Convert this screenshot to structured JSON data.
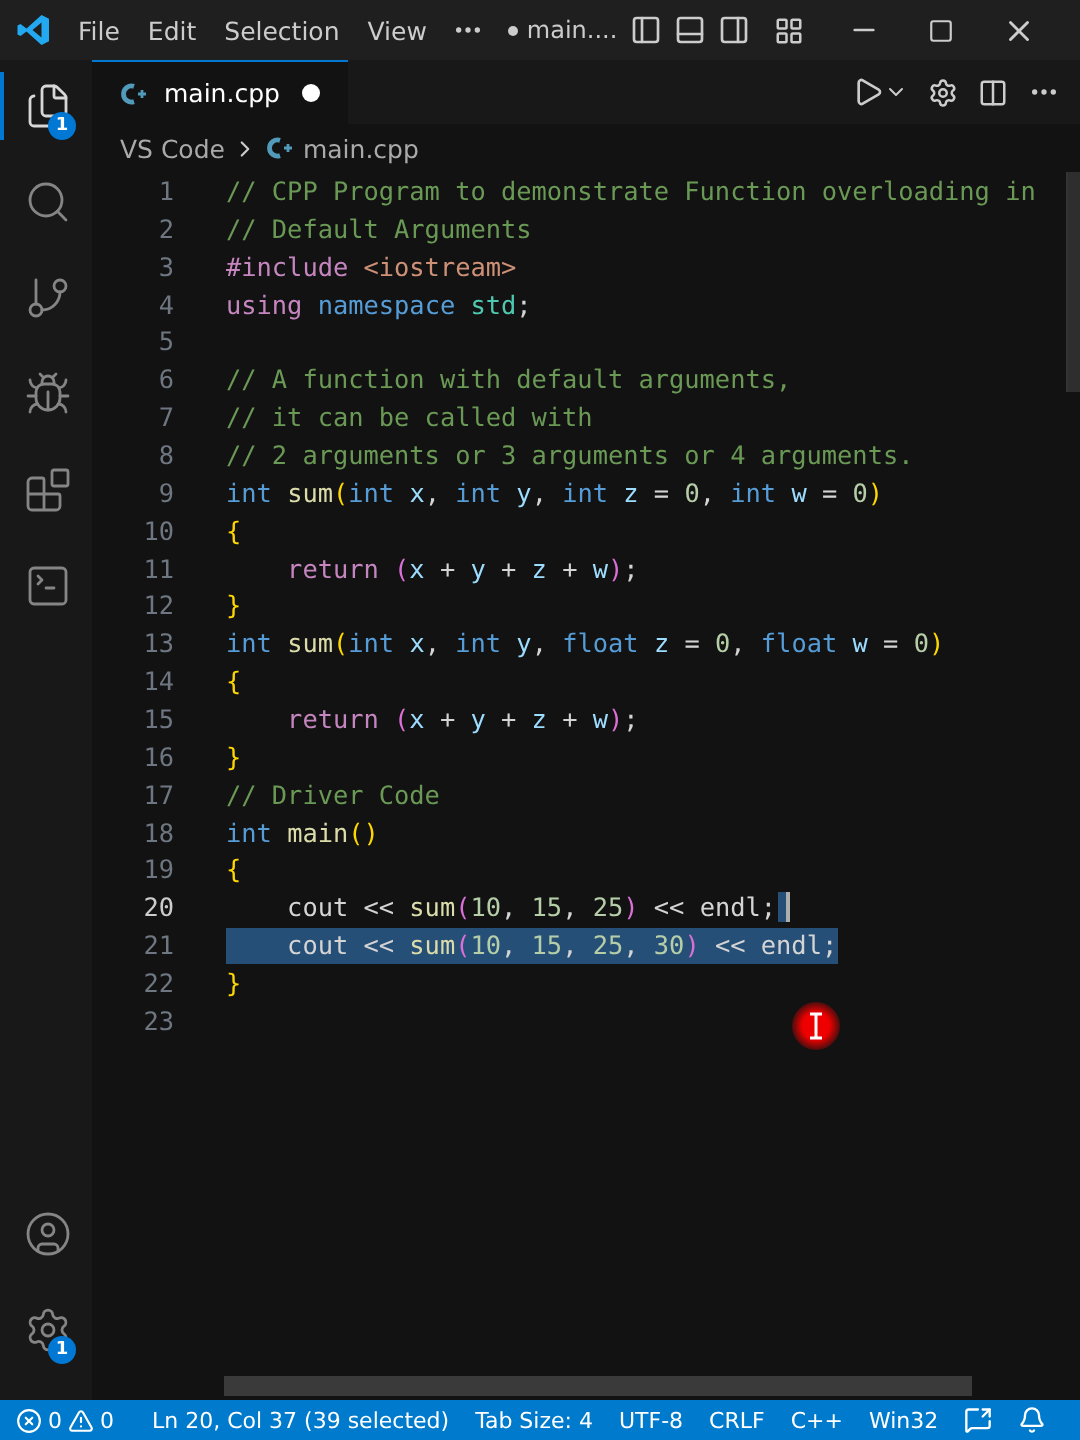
{
  "title_bar": {
    "menu": [
      "File",
      "Edit",
      "Selection",
      "View"
    ],
    "window_title": "main....",
    "modified": true
  },
  "activity_bar": [
    {
      "kind": "explorer",
      "selected": true,
      "badge": "1"
    },
    {
      "kind": "search",
      "selected": false
    },
    {
      "kind": "source-control",
      "selected": false
    },
    {
      "kind": "run-debug",
      "selected": false
    },
    {
      "kind": "extensions",
      "selected": false
    },
    {
      "kind": "terminal",
      "selected": false
    },
    {
      "kind": "account",
      "selected": false
    },
    {
      "kind": "manage",
      "selected": false,
      "badge": "1"
    }
  ],
  "tab": {
    "label": "main.cpp",
    "modified": true
  },
  "breadcrumbs": [
    "VS Code",
    "main.cpp"
  ],
  "lines": [
    {
      "number": "1",
      "current": false,
      "selected": false,
      "tokens": [
        {
          "kind": "comment",
          "text": "// CPP Program to demonstrate Function overloading in"
        }
      ]
    },
    {
      "number": "2",
      "current": false,
      "selected": false,
      "tokens": [
        {
          "kind": "comment",
          "text": "// Default Arguments"
        }
      ]
    },
    {
      "number": "3",
      "current": false,
      "selected": false,
      "tokens": [
        {
          "kind": "control",
          "text": "#include "
        },
        {
          "kind": "string",
          "text": "<iostream>"
        }
      ]
    },
    {
      "number": "4",
      "current": false,
      "selected": false,
      "tokens": [
        {
          "kind": "control",
          "text": "using "
        },
        {
          "kind": "type",
          "text": "namespace "
        },
        {
          "kind": "ns",
          "text": "std"
        },
        {
          "kind": "plain",
          "text": ";"
        }
      ]
    },
    {
      "number": "5",
      "current": false,
      "selected": false
    },
    {
      "number": "6",
      "current": false,
      "selected": false,
      "tokens": [
        {
          "kind": "comment",
          "text": "// A function with default arguments,"
        }
      ]
    },
    {
      "number": "7",
      "current": false,
      "selected": false,
      "tokens": [
        {
          "kind": "comment",
          "text": "// it can be called with"
        }
      ]
    },
    {
      "number": "8",
      "current": false,
      "selected": false,
      "tokens": [
        {
          "kind": "comment",
          "text": "// 2 arguments or 3 arguments or 4 arguments."
        }
      ]
    },
    {
      "number": "9",
      "current": false,
      "selected": false,
      "tokens": [
        {
          "kind": "type",
          "text": "int "
        },
        {
          "kind": "func",
          "text": "sum"
        },
        {
          "kind": "brace",
          "text": "("
        },
        {
          "kind": "type",
          "text": "int "
        },
        {
          "kind": "var",
          "text": "x"
        },
        {
          "kind": "plain",
          "text": ", "
        },
        {
          "kind": "type",
          "text": "int "
        },
        {
          "kind": "var",
          "text": "y"
        },
        {
          "kind": "plain",
          "text": ", "
        },
        {
          "kind": "type",
          "text": "int "
        },
        {
          "kind": "var",
          "text": "z"
        },
        {
          "kind": "plain",
          "text": " = "
        },
        {
          "kind": "number",
          "text": "0"
        },
        {
          "kind": "plain",
          "text": ", "
        },
        {
          "kind": "type",
          "text": "int "
        },
        {
          "kind": "var",
          "text": "w"
        },
        {
          "kind": "plain",
          "text": " = "
        },
        {
          "kind": "number",
          "text": "0"
        },
        {
          "kind": "brace",
          "text": ")"
        }
      ]
    },
    {
      "number": "10",
      "current": false,
      "selected": false,
      "tokens": [
        {
          "kind": "brace",
          "text": "{"
        }
      ]
    },
    {
      "number": "11",
      "current": false,
      "selected": false,
      "tokens": [
        {
          "kind": "control",
          "text": "    return "
        },
        {
          "kind": "paren",
          "text": "("
        },
        {
          "kind": "var",
          "text": "x"
        },
        {
          "kind": "plain",
          "text": " + "
        },
        {
          "kind": "var",
          "text": "y"
        },
        {
          "kind": "plain",
          "text": " + "
        },
        {
          "kind": "var",
          "text": "z"
        },
        {
          "kind": "plain",
          "text": " + "
        },
        {
          "kind": "var",
          "text": "w"
        },
        {
          "kind": "paren",
          "text": ")"
        },
        {
          "kind": "plain",
          "text": ";"
        }
      ]
    },
    {
      "number": "12",
      "current": false,
      "selected": false,
      "tokens": [
        {
          "kind": "brace",
          "text": "}"
        }
      ]
    },
    {
      "number": "13",
      "current": false,
      "selected": false,
      "tokens": [
        {
          "kind": "type",
          "text": "int "
        },
        {
          "kind": "func",
          "text": "sum"
        },
        {
          "kind": "brace",
          "text": "("
        },
        {
          "kind": "type",
          "text": "int "
        },
        {
          "kind": "var",
          "text": "x"
        },
        {
          "kind": "plain",
          "text": ", "
        },
        {
          "kind": "type",
          "text": "int "
        },
        {
          "kind": "var",
          "text": "y"
        },
        {
          "kind": "plain",
          "text": ", "
        },
        {
          "kind": "type",
          "text": "float "
        },
        {
          "kind": "var",
          "text": "z"
        },
        {
          "kind": "plain",
          "text": " = "
        },
        {
          "kind": "number",
          "text": "0"
        },
        {
          "kind": "plain",
          "text": ", "
        },
        {
          "kind": "type",
          "text": "float "
        },
        {
          "kind": "var",
          "text": "w"
        },
        {
          "kind": "plain",
          "text": " = "
        },
        {
          "kind": "number",
          "text": "0"
        },
        {
          "kind": "brace",
          "text": ")"
        }
      ]
    },
    {
      "number": "14",
      "current": false,
      "selected": false,
      "tokens": [
        {
          "kind": "brace",
          "text": "{"
        }
      ]
    },
    {
      "number": "15",
      "current": false,
      "selected": false,
      "tokens": [
        {
          "kind": "control",
          "text": "    return "
        },
        {
          "kind": "paren",
          "text": "("
        },
        {
          "kind": "var",
          "text": "x"
        },
        {
          "kind": "plain",
          "text": " + "
        },
        {
          "kind": "var",
          "text": "y"
        },
        {
          "kind": "plain",
          "text": " + "
        },
        {
          "kind": "var",
          "text": "z"
        },
        {
          "kind": "plain",
          "text": " + "
        },
        {
          "kind": "var",
          "text": "w"
        },
        {
          "kind": "paren",
          "text": ")"
        },
        {
          "kind": "plain",
          "text": ";"
        }
      ]
    },
    {
      "number": "16",
      "current": false,
      "selected": false,
      "tokens": [
        {
          "kind": "brace",
          "text": "}"
        }
      ]
    },
    {
      "number": "17",
      "current": false,
      "selected": false,
      "tokens": [
        {
          "kind": "comment",
          "text": "// Driver Code"
        }
      ]
    },
    {
      "number": "18",
      "current": false,
      "selected": false,
      "tokens": [
        {
          "kind": "type",
          "text": "int "
        },
        {
          "kind": "func",
          "text": "main"
        },
        {
          "kind": "brace",
          "text": "()"
        }
      ]
    },
    {
      "number": "19",
      "current": false,
      "selected": false,
      "tokens": [
        {
          "kind": "brace",
          "text": "{"
        }
      ]
    },
    {
      "number": "20",
      "current": true,
      "selected": false,
      "tokens": [
        {
          "kind": "plain",
          "text": "    cout << "
        },
        {
          "kind": "func",
          "text": "sum"
        },
        {
          "kind": "paren",
          "text": "("
        },
        {
          "kind": "number",
          "text": "10"
        },
        {
          "kind": "plain",
          "text": ", "
        },
        {
          "kind": "number",
          "text": "15"
        },
        {
          "kind": "plain",
          "text": ", "
        },
        {
          "kind": "number",
          "text": "25"
        },
        {
          "kind": "paren",
          "text": ")"
        },
        {
          "kind": "plain",
          "text": " << endl;"
        }
      ]
    },
    {
      "number": "21",
      "current": false,
      "selected": true,
      "tokens": [
        {
          "kind": "plain",
          "text": "    cout << "
        },
        {
          "kind": "func",
          "text": "sum"
        },
        {
          "kind": "paren",
          "text": "("
        },
        {
          "kind": "number",
          "text": "10"
        },
        {
          "kind": "plain",
          "text": ", "
        },
        {
          "kind": "number",
          "text": "15"
        },
        {
          "kind": "plain",
          "text": ", "
        },
        {
          "kind": "number",
          "text": "25"
        },
        {
          "kind": "plain",
          "text": ", "
        },
        {
          "kind": "number",
          "text": "30"
        },
        {
          "kind": "paren",
          "text": ")"
        },
        {
          "kind": "plain",
          "text": " << endl;"
        }
      ]
    },
    {
      "number": "22",
      "current": false,
      "selected": false,
      "tokens": [
        {
          "kind": "brace",
          "text": "}"
        }
      ]
    },
    {
      "number": "23",
      "current": false,
      "selected": false
    }
  ],
  "status_bar": {
    "errors": "0",
    "warnings": "0",
    "items": [
      "Ln 20, Col 37 (39 selected)",
      "Tab Size: 4",
      "UTF-8",
      "CRLF",
      "C++",
      "Win32"
    ]
  }
}
